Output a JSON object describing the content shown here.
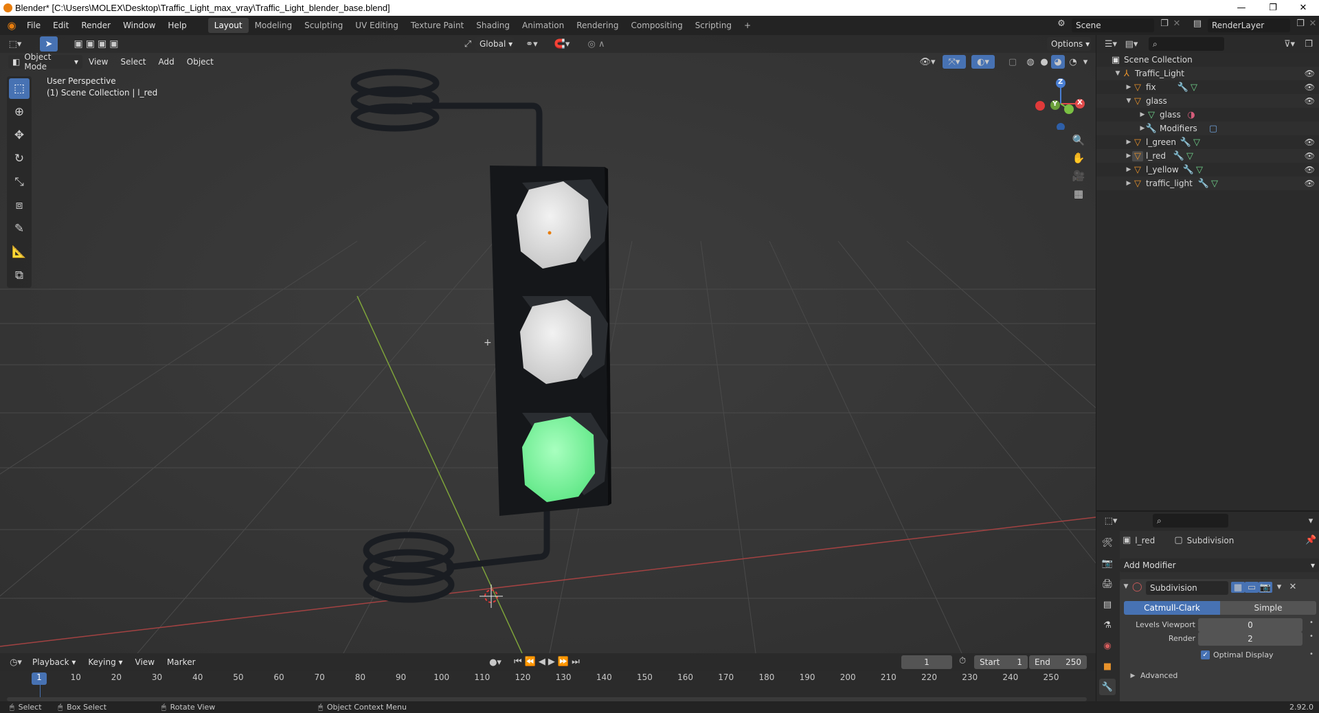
{
  "window": {
    "title": "Blender* [C:\\Users\\MOLEX\\Desktop\\Traffic_Light_max_vray\\Traffic_Light_blender_base.blend]",
    "minimize": "—",
    "maximize": "❐",
    "close": "✕"
  },
  "menubar": {
    "items": [
      "File",
      "Edit",
      "Render",
      "Window",
      "Help"
    ]
  },
  "workspaces": {
    "tabs": [
      "Layout",
      "Modeling",
      "Sculpting",
      "UV Editing",
      "Texture Paint",
      "Shading",
      "Animation",
      "Rendering",
      "Compositing",
      "Scripting"
    ],
    "active": "Layout",
    "add": "+"
  },
  "scene": {
    "name": "Scene",
    "render_layer": "RenderLayer"
  },
  "viewport": {
    "mode": "Object Mode",
    "menus": [
      "View",
      "Select",
      "Add",
      "Object"
    ],
    "transform_orientation": "Global",
    "options": "Options",
    "overlay_title": "User Perspective",
    "overlay_subtitle": "(1) Scene Collection | l_red",
    "gizmo": {
      "x": "X",
      "y": "Y",
      "z": "Z"
    }
  },
  "outliner": {
    "root": "Scene Collection",
    "collection": "Traffic_Light",
    "items": [
      {
        "name": "fix",
        "level": 1,
        "expanded": false
      },
      {
        "name": "glass",
        "level": 1,
        "expanded": true
      },
      {
        "name": "glass",
        "level": 2,
        "expanded": false
      },
      {
        "name": "Modifiers",
        "level": 2,
        "expanded": false
      },
      {
        "name": "l_green",
        "level": 1,
        "expanded": false
      },
      {
        "name": "l_red",
        "level": 1,
        "expanded": false
      },
      {
        "name": "l_yellow",
        "level": 1,
        "expanded": false
      },
      {
        "name": "traffic_light",
        "level": 1,
        "expanded": false
      }
    ]
  },
  "properties": {
    "object": "l_red",
    "modifier_crumb": "Subdivision",
    "add_modifier": "Add Modifier",
    "modifier": {
      "name": "Subdivision",
      "algorithms": [
        "Catmull-Clark",
        "Simple"
      ],
      "active_algorithm": "Catmull-Clark",
      "levels_viewport_label": "Levels Viewport",
      "levels_viewport": "0",
      "render_label": "Render",
      "render": "2",
      "optimal_display": "Optimal Display",
      "optimal_checked": true,
      "advanced": "Advanced"
    }
  },
  "timeline": {
    "menus": [
      "Playback",
      "Keying",
      "View",
      "Marker"
    ],
    "current_frame": "1",
    "start_label": "Start",
    "start": "1",
    "end_label": "End",
    "end": "250",
    "ticks": [
      "1",
      "10",
      "20",
      "30",
      "40",
      "50",
      "60",
      "70",
      "80",
      "90",
      "100",
      "110",
      "120",
      "130",
      "140",
      "150",
      "160",
      "170",
      "180",
      "190",
      "200",
      "210",
      "220",
      "230",
      "240",
      "250"
    ]
  },
  "statusbar": {
    "select": "Select",
    "box_select": "Box Select",
    "rotate_view": "Rotate View",
    "context_menu": "Object Context Menu",
    "version": "2.92.0"
  },
  "colors": {
    "accent": "#4772b3",
    "object_orange": "#e8922b",
    "mesh_green": "#6fd18a",
    "light_green": "#7dffa0"
  }
}
